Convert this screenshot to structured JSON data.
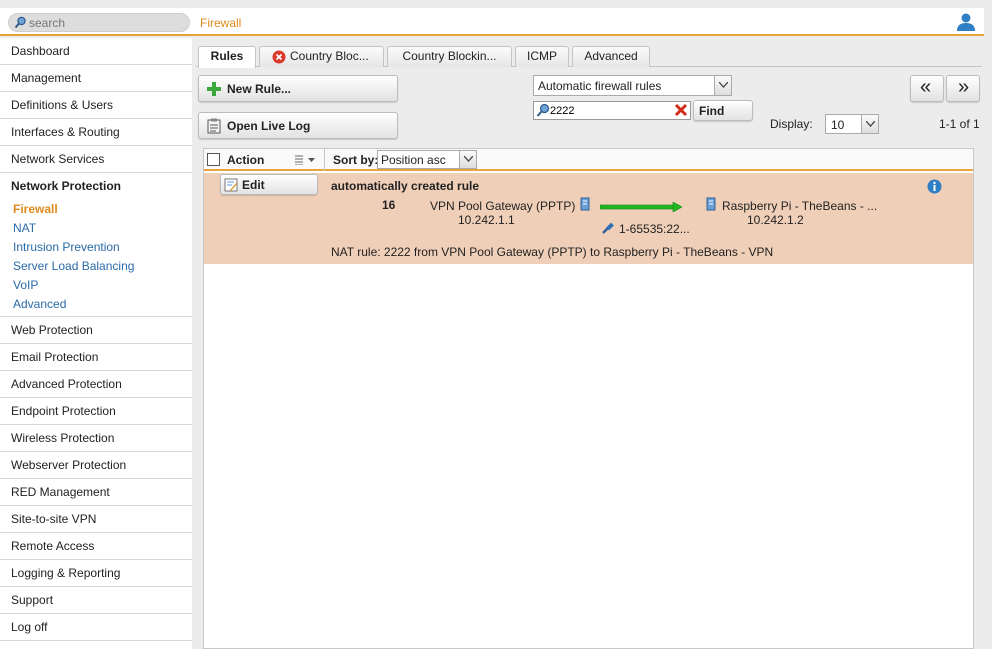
{
  "header": {
    "search_placeholder": "search",
    "page_title": "Firewall"
  },
  "sidebar": {
    "items_top": [
      "Dashboard",
      "Management",
      "Definitions & Users",
      "Interfaces & Routing",
      "Network Services"
    ],
    "active_group": "Network Protection",
    "sub_items": [
      "Firewall",
      "NAT",
      "Intrusion Prevention",
      "Server Load Balancing",
      "VoIP",
      "Advanced"
    ],
    "active_sub": "Firewall",
    "items_bottom": [
      "Web Protection",
      "Email Protection",
      "Advanced Protection",
      "Endpoint Protection",
      "Wireless Protection",
      "Webserver Protection",
      "RED Management",
      "Site-to-site VPN",
      "Remote Access",
      "Logging & Reporting",
      "Support",
      "Log off"
    ]
  },
  "tabs": [
    "Rules",
    "Country Bloc...",
    "Country Blockin...",
    "ICMP",
    "Advanced"
  ],
  "toolbar": {
    "new_rule": "New Rule...",
    "open_live_log": "Open Live Log",
    "rule_filter_selected": "Automatic firewall rules",
    "search_value": "2222",
    "find": "Find",
    "display_label": "Display:",
    "display_value": "10",
    "pager_prev": "«",
    "pager_next": "»",
    "count": "1-1 of 1"
  },
  "list": {
    "action_label": "Action",
    "sort_label": "Sort by:",
    "sort_value": "Position asc",
    "rows": [
      {
        "edit_label": "Edit",
        "title": "automatically created rule",
        "position": "16",
        "source_name": "VPN Pool Gateway (PPTP)",
        "source_ip": "10.242.1.1",
        "service": "1-65535:22...",
        "dest_name": "Raspberry Pi - TheBeans - ...",
        "dest_ip": "10.242.1.2",
        "comment": "NAT rule: 2222 from VPN Pool Gateway (PPTP) to Raspberry Pi - TheBeans - VPN"
      }
    ]
  },
  "colors": {
    "accent": "#e8a33d",
    "title_orange": "#e08a1e",
    "link_blue": "#2a6aa8",
    "row_highlight": "#f0cfb8",
    "arrow_green": "#22b522"
  },
  "icons": {
    "search": "magnifier-icon",
    "user": "user-icon",
    "new_rule": "plus-icon",
    "live_log": "log-icon",
    "error_tab": "error-circle-icon",
    "clear": "clear-x-icon",
    "info": "info-icon",
    "network": "network-host-icon",
    "service": "service-plug-icon",
    "arrow": "green-arrow-icon"
  }
}
